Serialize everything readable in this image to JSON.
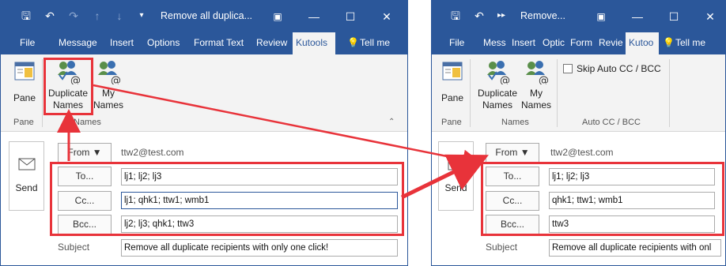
{
  "left": {
    "title": "Remove all duplica...",
    "tabs": [
      "File",
      "Message",
      "Insert",
      "Options",
      "Format Text",
      "Review",
      "Kutools",
      "Tell me"
    ],
    "ribbon": {
      "pane_label": "Pane",
      "dup_line1": "Duplicate",
      "dup_line2": "Names",
      "my_line1": "My",
      "my_line2": "Names",
      "group_pane": "Pane",
      "group_names": "Names"
    },
    "compose": {
      "send": "Send",
      "from_label": "From",
      "from_value": "ttw2@test.com",
      "to_label": "To...",
      "to_value": "lj1; lj2; lj3",
      "cc_label": "Cc...",
      "cc_value": "lj1; qhk1; ttw1; wmb1",
      "bcc_label": "Bcc...",
      "bcc_value": "lj2; lj3; qhk1; ttw3",
      "subject_label": "Subject",
      "subject_value": "Remove all duplicate recipients with only one click!"
    }
  },
  "right": {
    "title": "Remove...",
    "tabs": [
      "File",
      "Mess",
      "Insert",
      "Optic",
      "Form",
      "Revie",
      "Kutoo",
      "Tell me"
    ],
    "ribbon": {
      "pane_label": "Pane",
      "dup_line1": "Duplicate",
      "dup_line2": "Names",
      "my_line1": "My",
      "my_line2": "Names",
      "skip_label": "Skip Auto CC / BCC",
      "group_pane": "Pane",
      "group_names": "Names",
      "group_auto": "Auto CC / BCC"
    },
    "compose": {
      "send": "Send",
      "from_label": "From",
      "from_value": "ttw2@test.com",
      "to_label": "To...",
      "to_value": "lj1; lj2; lj3",
      "cc_label": "Cc...",
      "cc_value": "qhk1; ttw1; wmb1",
      "bcc_label": "Bcc...",
      "bcc_value": "ttw3",
      "subject_label": "Subject",
      "subject_value": "Remove all duplicate recipients with onl"
    }
  },
  "colors": {
    "title_bar": "#2b579a",
    "ribbon_bg": "#f3f3f3",
    "highlight": "#e8333a"
  },
  "icons": [
    "save-icon",
    "undo-icon",
    "redo-icon",
    "up-icon",
    "down-icon",
    "customize-icon",
    "restore-icon",
    "minimize-icon",
    "maximize-icon",
    "close-icon",
    "lightbulb-icon",
    "pane-icon",
    "duplicate-names-icon",
    "my-names-icon",
    "envelope-icon",
    "dropdown-icon",
    "collapse-icon"
  ]
}
